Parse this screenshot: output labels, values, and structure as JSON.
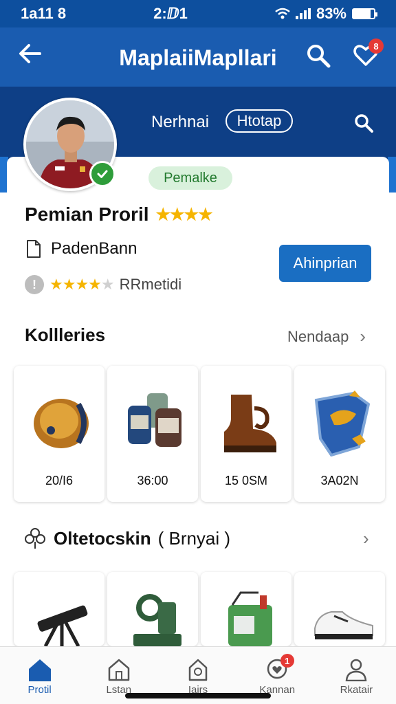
{
  "status_bar": {
    "left": "1a11 8",
    "time": "2:ⅅ1",
    "battery": "83%"
  },
  "app_bar": {
    "title": "MaplaiiMapllari",
    "notification_count": "8"
  },
  "profile": {
    "header_name": "Nerhnai",
    "header_pill": "Htotap",
    "chip": "Pemalke",
    "title": "Pemian Proril",
    "doc_label": "PadenBann",
    "rating_text": "RRmetidi",
    "action_button": "Ahinprian"
  },
  "collections": {
    "title": "Kollleries",
    "link": "Nendaap",
    "items": [
      {
        "icon": "gold-ball-icon",
        "value": "20/​​I6"
      },
      {
        "icon": "canisters-icon",
        "value": "36:00"
      },
      {
        "icon": "boot-icon",
        "value": "15 0SM"
      },
      {
        "icon": "shield-crest-icon",
        "value": "3A0​​2N"
      }
    ]
  },
  "others": {
    "title": "Oltetocskin",
    "subtitle": "( Brnyai )",
    "items": [
      {
        "icon": "telescope-icon"
      },
      {
        "icon": "machine-icon"
      },
      {
        "icon": "kit-box-icon"
      },
      {
        "icon": "sneaker-icon"
      }
    ]
  },
  "bottom_nav": {
    "items": [
      {
        "label": "Protil",
        "icon": "home-icon",
        "active": true
      },
      {
        "label": "Lstan",
        "icon": "house-outline-icon"
      },
      {
        "label": "Iairs",
        "icon": "document-icon"
      },
      {
        "label": "Kannan",
        "icon": "chat-heart-icon",
        "badge": "1"
      },
      {
        "label": "Rkatair",
        "icon": "person-icon"
      }
    ]
  },
  "colors": {
    "primary": "#1a5cb0",
    "header_dark": "#0e3f86",
    "star": "#f5b400",
    "success": "#2e9d3a",
    "badge": "#e53935"
  }
}
